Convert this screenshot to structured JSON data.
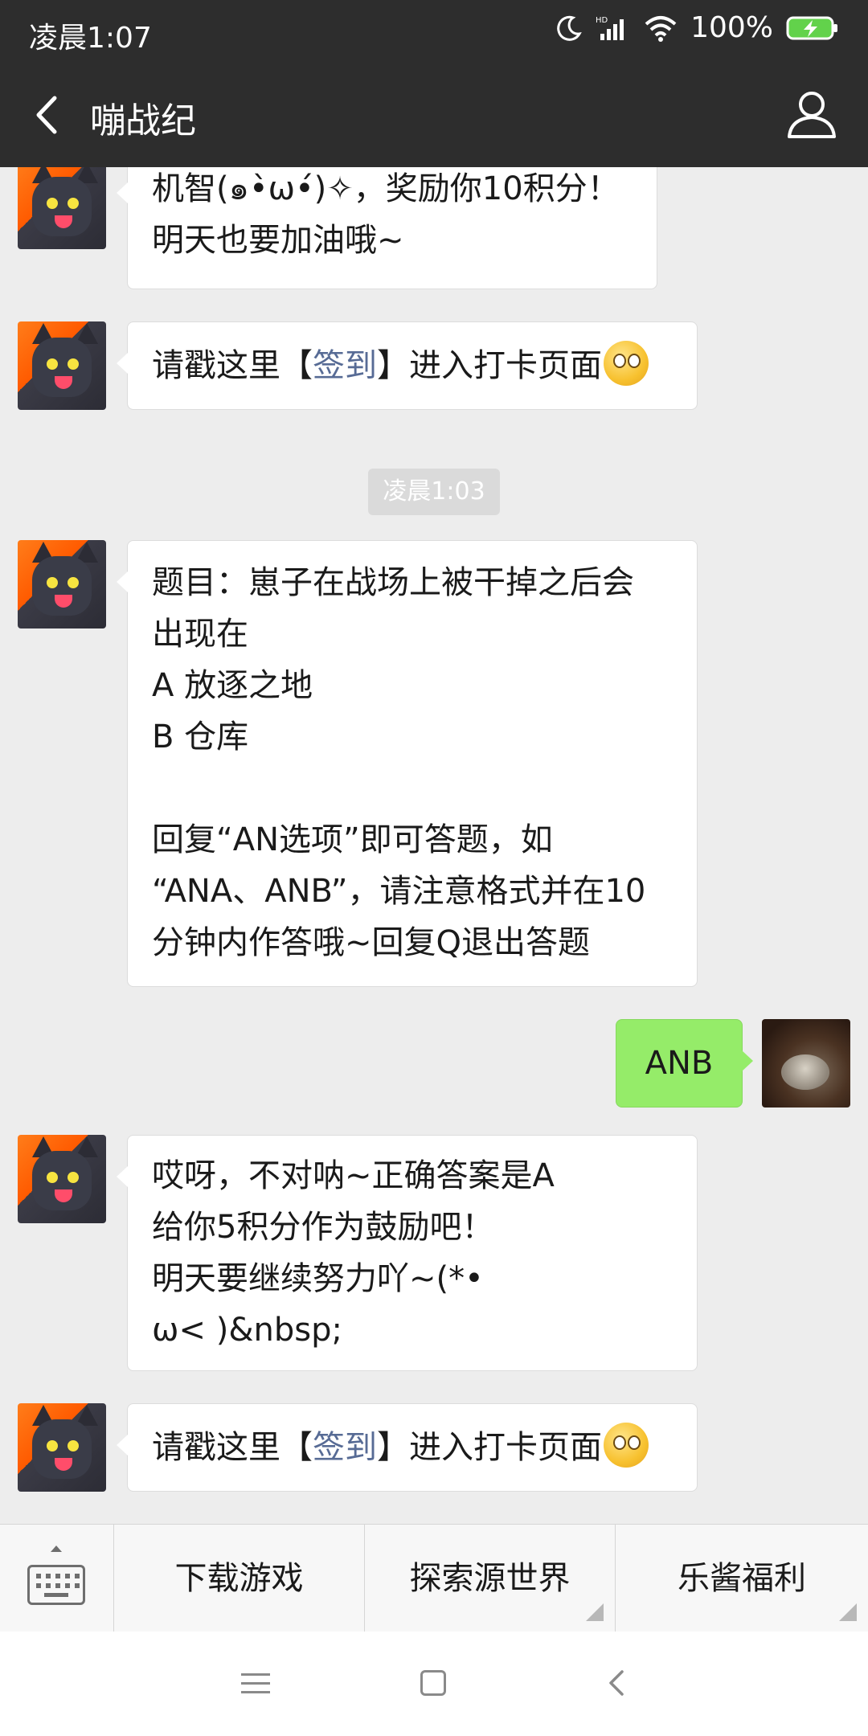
{
  "status_bar": {
    "time": "凌晨1:07",
    "battery_percent": "100%",
    "icons": [
      "moon-icon",
      "hd-signal-icon",
      "wifi-icon",
      "battery-charging-icon"
    ]
  },
  "header": {
    "title": "嘣战纪",
    "icons": [
      "back-arrow-icon",
      "profile-icon"
    ]
  },
  "messages": {
    "m1": {
      "lines": [
        "机智(๑•̀ω•́)✧，奖励你10积分！",
        "明天也要加油哦~"
      ]
    },
    "m2": {
      "prefix": "请戳这里【",
      "link": "签到",
      "suffix": "】进入打卡页面"
    },
    "timestamp": "凌晨1:03",
    "m3": {
      "lines": [
        "题目：崽子在战场上被干掉之后会",
        "出现在",
        "A 放逐之地",
        "B 仓库",
        "",
        "回复“AN选项”即可答题，如",
        "“ANA、ANB”，请注意格式并在10",
        "分钟内作答哦~回复Q退出答题"
      ]
    },
    "m4": {
      "text": "ANB"
    },
    "m5": {
      "lines": [
        "哎呀，不对呐~正确答案是A",
        "给你5积分作为鼓励吧！",
        "明天要继续努力吖~(*•",
        "ω< )&nbsp;"
      ]
    },
    "m6": {
      "prefix": "请戳这里【",
      "link": "签到",
      "suffix": "】进入打卡页面"
    }
  },
  "menu": {
    "items": [
      "下载游戏",
      "探索源世界",
      "乐酱福利"
    ]
  },
  "colors": {
    "title_bar": "#2d2d2d",
    "chat_background": "#ededed",
    "outgoing_bubble": "#95ec69",
    "link": "#576b95"
  }
}
